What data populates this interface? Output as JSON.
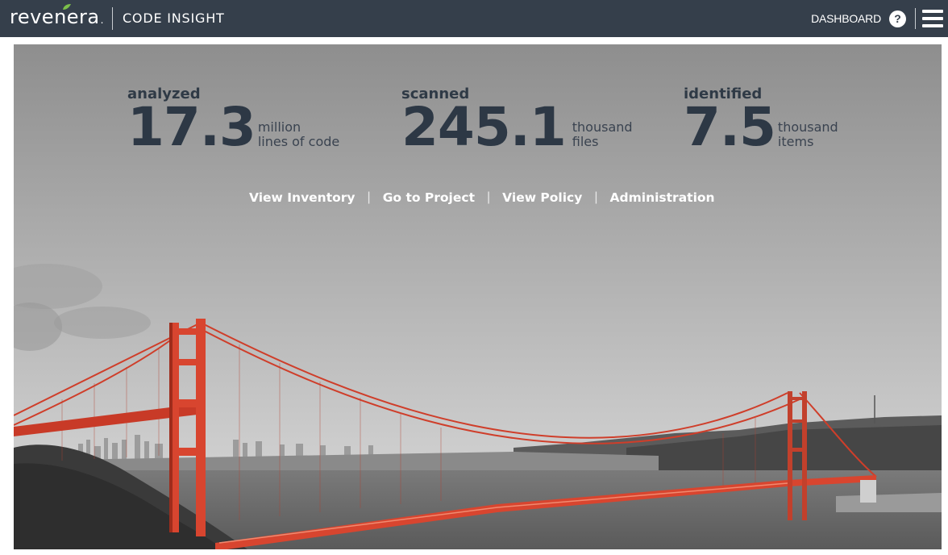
{
  "header": {
    "logo_text": "revenera",
    "logo_dot": ".",
    "product_name": "CODE INSIGHT",
    "dashboard_label": "DASHBOARD",
    "help_symbol": "?",
    "icons": {
      "help": "help-icon",
      "menu": "hamburger-menu-icon"
    }
  },
  "stats": [
    {
      "label": "analyzed",
      "value": "17.3",
      "unit_line1": "million",
      "unit_line2": "lines of code"
    },
    {
      "label": "scanned",
      "value": "245.1",
      "unit_line1": "thousand",
      "unit_line2": "files"
    },
    {
      "label": "identified",
      "value": "7.5",
      "unit_line1": "thousand",
      "unit_line2": "items"
    }
  ],
  "links": [
    {
      "label": "View Inventory"
    },
    {
      "label": "Go to Project"
    },
    {
      "label": "View Policy"
    },
    {
      "label": "Administration"
    }
  ],
  "separator": "|",
  "colors": {
    "topbar": "#353f4b",
    "bridge": "#d8452f",
    "leaf": "#7cc04a",
    "stat_text": "#2d3845"
  }
}
